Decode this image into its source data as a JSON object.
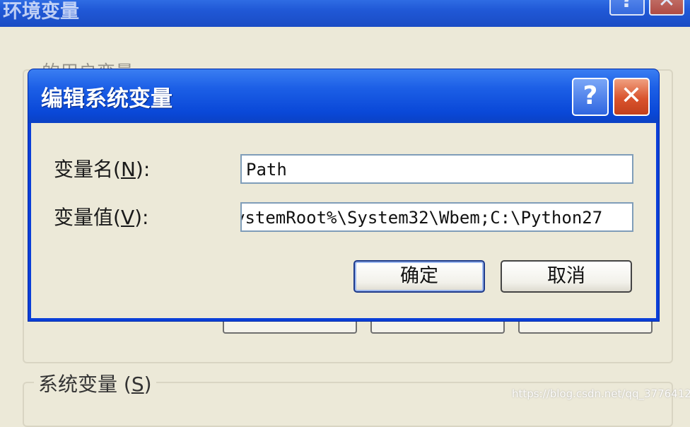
{
  "background_window": {
    "title": "环境变量",
    "help_glyph": "?",
    "close_glyph": "✕",
    "user_vars_label": "的用户变量",
    "system_vars_label": "系统变量",
    "system_vars_mnemonic": "S"
  },
  "dialog": {
    "title": "编辑系统变量",
    "help_glyph": "?",
    "close_glyph": "✕",
    "variable_name_label": "变量名",
    "variable_name_mnemonic": "N",
    "variable_value_label": "变量值",
    "variable_value_mnemonic": "V",
    "variable_name_value": "Path",
    "variable_value_value": "ystemRoot%\\System32\\Wbem;C:\\Python27",
    "ok_label": "确定",
    "cancel_label": "取消"
  },
  "watermark": "https://blog.csdn.net/qq_37764129",
  "colors": {
    "titlebar_blue": "#0a48d8",
    "close_red": "#d9532d",
    "dialog_face": "#ece9d8"
  }
}
